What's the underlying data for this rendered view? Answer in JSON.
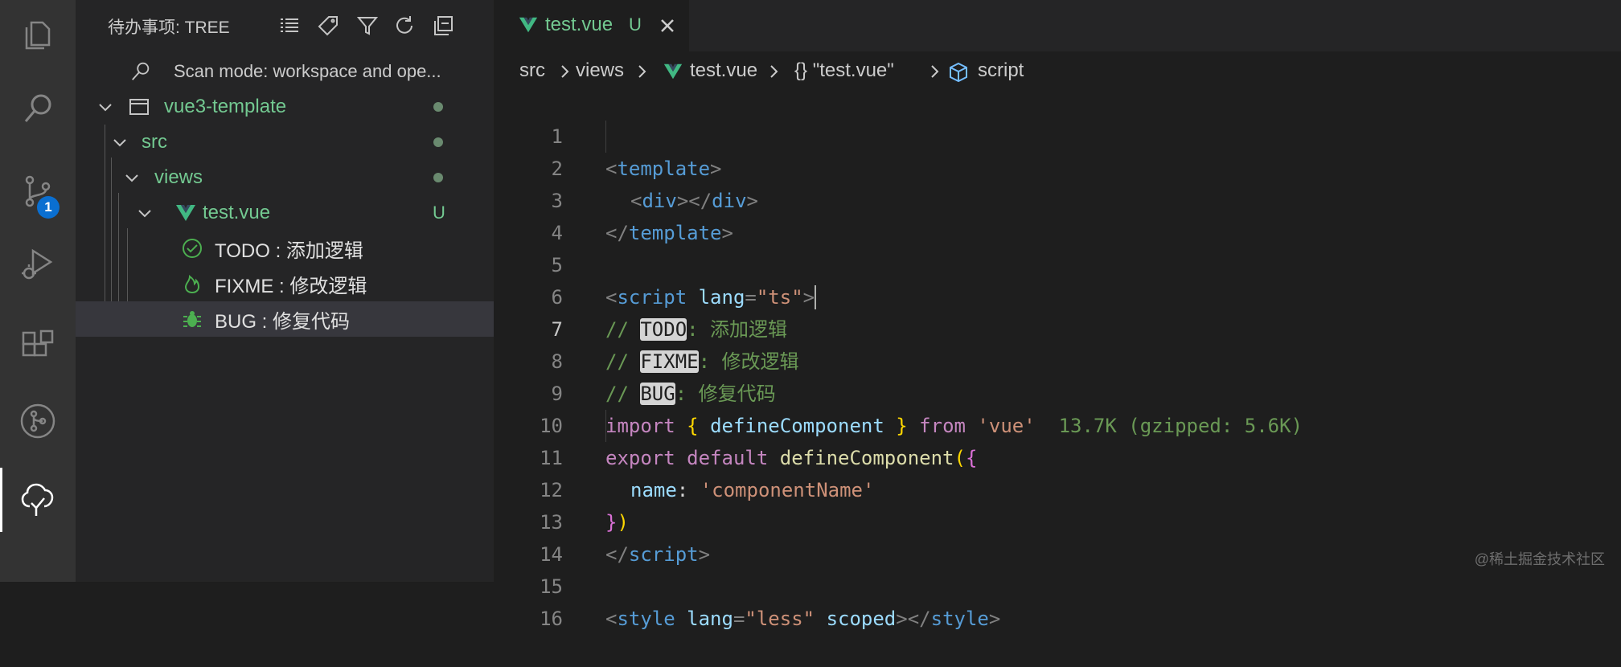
{
  "activity_bar": {
    "items": [
      {
        "name": "explorer-icon"
      },
      {
        "name": "search-icon"
      },
      {
        "name": "source-control-icon",
        "badge": "1"
      },
      {
        "name": "run-debug-icon"
      },
      {
        "name": "extensions-icon"
      },
      {
        "name": "git-graph-icon"
      },
      {
        "name": "todo-tree-icon",
        "active": true
      }
    ]
  },
  "sidebar": {
    "title": "待办事项: TREE",
    "toolbar_icons": [
      "list-flat-icon",
      "tag-icon",
      "filter-icon",
      "refresh-icon",
      "collapse-all-icon"
    ],
    "scan_mode": "Scan mode: workspace and ope...",
    "tree": [
      {
        "label": "vue3-template",
        "type": "folder-root"
      },
      {
        "label": "src",
        "type": "folder"
      },
      {
        "label": "views",
        "type": "folder"
      },
      {
        "label": "test.vue",
        "type": "file",
        "status": "U"
      },
      {
        "label": "TODO : 添加逻辑",
        "type": "todo",
        "icon": "check-circle-icon"
      },
      {
        "label": "FIXME : 修改逻辑",
        "type": "fixme",
        "icon": "flame-icon"
      },
      {
        "label": "BUG : 修复代码",
        "type": "bug",
        "icon": "bug-icon"
      }
    ]
  },
  "editor": {
    "tab": {
      "label": "test.vue",
      "status": "U"
    },
    "breadcrumb": [
      "src",
      "views",
      "test.vue",
      "{} \"test.vue\"",
      "script"
    ],
    "lines": [
      "1",
      "2",
      "3",
      "4",
      "5",
      "6",
      "7",
      "8",
      "9",
      "10",
      "11",
      "12",
      "13",
      "14",
      "15",
      "16"
    ],
    "current_line": "7",
    "code": {
      "l1_tag": "template",
      "l2_tag_open": "div",
      "l2_tag_close": "div",
      "l3_tag": "template",
      "l5_tag": "script",
      "l5_attr": "lang",
      "l5_val": "\"ts\"",
      "l6_comment_prefix": "// ",
      "l6_keyword": "TODO",
      "l6_rest": ": 添加逻辑",
      "l7_comment_prefix": "// ",
      "l7_keyword": "FIXME",
      "l7_rest": ": 修改逻辑",
      "l8_comment_prefix": "// ",
      "l8_keyword": "BUG",
      "l8_rest": ": 修复代码",
      "l9_import": "import",
      "l9_ident": "defineComponent",
      "l9_from": "from",
      "l9_module": "'vue'",
      "l9_hint": "13.7K (gzipped: 5.6K)",
      "l10_export": "export",
      "l10_default": "default",
      "l10_fn": "defineComponent",
      "l11_prop": "name",
      "l11_val": "'componentName'",
      "l13_tag": "script",
      "l15_tag": "style",
      "l15_attr1": "lang",
      "l15_val1": "\"less\"",
      "l15_attr2": "scoped",
      "l15_tag_close": "style"
    }
  },
  "watermark": "@稀土掘金技术社区"
}
